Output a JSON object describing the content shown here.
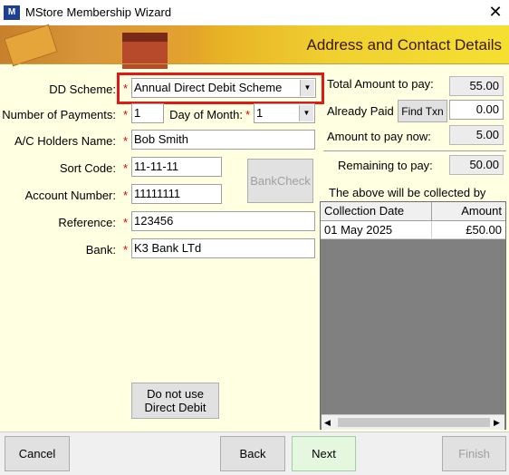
{
  "window": {
    "title": "MStore Membership Wizard",
    "app_icon": "M",
    "close_glyph": "✕"
  },
  "banner": {
    "title": "Address and Contact Details"
  },
  "form": {
    "dd_scheme_label": "DD Scheme:",
    "dd_scheme_value": "Annual Direct Debit Scheme",
    "num_payments_label": "Number of Payments:",
    "num_payments_value": "1",
    "day_of_month_label": "Day of Month:",
    "day_of_month_value": "1",
    "holder_label": "A/C Holders Name:",
    "holder_value": "Bob Smith",
    "sort_code_label": "Sort Code:",
    "sort_code_value": "11-11-11",
    "account_label": "Account Number:",
    "account_value": "11111111",
    "reference_label": "Reference:",
    "reference_value": "123456",
    "bank_label": "Bank:",
    "bank_value": "K3 Bank LTd",
    "required_mark": "*",
    "bankcheck_label": "BankCheck",
    "no_dd_line1": "Do not use",
    "no_dd_line2": "Direct Debit"
  },
  "summary": {
    "total_label": "Total Amount to pay:",
    "total_value": "55.00",
    "already_paid_label": "Already Paid",
    "find_txn_label": "Find Txn",
    "already_paid_value": "0.00",
    "now_label": "Amount to pay now:",
    "now_value": "5.00",
    "remaining_label": "Remaining to pay:",
    "remaining_value": "50.00",
    "collected_note": "The above will be collected by DD:"
  },
  "schedule": {
    "columns": [
      "Collection Date",
      "Amount"
    ],
    "rows": [
      {
        "date": "01 May 2025",
        "amount": "£50.00"
      }
    ]
  },
  "buttons": {
    "cancel": "Cancel",
    "back": "Back",
    "next": "Next",
    "finish": "Finish"
  },
  "colors": {
    "highlight": "#e01818",
    "required": "#e00000",
    "next_bg": "#e6f7e0"
  }
}
